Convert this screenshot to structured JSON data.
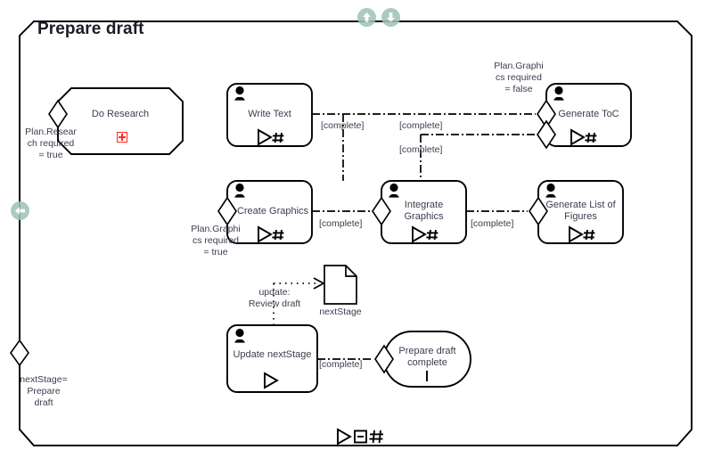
{
  "frame": {
    "title": "Prepare draft",
    "shape": "rounded-corner-activity-frame"
  },
  "scroll_controls": [
    {
      "name": "scroll-up-icon",
      "glyph": "arrow-up-circle"
    },
    {
      "name": "scroll-down-icon",
      "glyph": "arrow-down-circle"
    },
    {
      "name": "scroll-left-icon",
      "glyph": "arrow-left-circle"
    }
  ],
  "toolbar": {
    "glyphs": [
      "play-triangle",
      "collapse-box",
      "hash"
    ]
  },
  "colors": {
    "stroke": "#000000",
    "text": "#3c3c50",
    "title": "#1b1b24",
    "expand_marker": "#ff2a1f",
    "scroll_icon": "#9fc4b4"
  },
  "nodes": [
    {
      "id": "do-research",
      "label": "Do Research",
      "shape": "octagon",
      "has_actor_icon": false,
      "markers": [],
      "expand_marker": true,
      "pins": [
        "left-diamond"
      ]
    },
    {
      "id": "write-text",
      "label": "Write Text",
      "shape": "rounded-rect",
      "has_actor_icon": true,
      "markers": [
        "play-triangle",
        "hash"
      ],
      "expand_marker": false,
      "pins": []
    },
    {
      "id": "generate-toc",
      "label": "Generate ToC",
      "shape": "rounded-rect",
      "has_actor_icon": true,
      "markers": [
        "play-triangle",
        "hash"
      ],
      "expand_marker": false,
      "pins": [
        "left-diamond",
        "left-diamond"
      ]
    },
    {
      "id": "create-graphics",
      "label": "Create Graphics",
      "shape": "rounded-rect",
      "has_actor_icon": true,
      "markers": [
        "play-triangle",
        "hash"
      ],
      "expand_marker": false,
      "pins": [
        "left-diamond"
      ]
    },
    {
      "id": "integrate-graphics",
      "label": "Integrate\nGraphics",
      "shape": "rounded-rect",
      "has_actor_icon": true,
      "markers": [
        "play-triangle",
        "hash"
      ],
      "expand_marker": false,
      "pins": [
        "left-diamond"
      ]
    },
    {
      "id": "generate-list-of-figures",
      "label": "Generate List of\nFigures",
      "shape": "rounded-rect",
      "has_actor_icon": true,
      "markers": [
        "play-triangle",
        "hash"
      ],
      "expand_marker": false,
      "pins": [
        "left-diamond"
      ]
    },
    {
      "id": "update-nextstage",
      "label": "Update nextStage",
      "shape": "rounded-rect",
      "has_actor_icon": true,
      "markers": [
        "play-triangle"
      ],
      "expand_marker": false,
      "pins": []
    },
    {
      "id": "prepare-draft-complete",
      "label": "Prepare draft\ncomplete",
      "shape": "stadium",
      "has_actor_icon": false,
      "markers": [],
      "expand_marker": false,
      "pins": [
        "left-diamond"
      ]
    }
  ],
  "artifacts": [
    {
      "id": "nextstage-document",
      "label": "nextStage",
      "shape": "document"
    }
  ],
  "guards": [
    {
      "id": "guard-do-research",
      "text": "Plan.Resear\nch required\n= true"
    },
    {
      "id": "guard-create-graphics",
      "text": "Plan.Graphi\ncs required\n= true"
    },
    {
      "id": "guard-generate-toc",
      "text": "Plan.Graphi\ncs required\n= false"
    },
    {
      "id": "guard-frame-entry",
      "text": "nextStage=\nPrepare\ndraft"
    }
  ],
  "edge_labels": [
    {
      "id": "edge-write-text-out",
      "text": "[complete]"
    },
    {
      "id": "edge-to-generate-toc",
      "text": "[complete]"
    },
    {
      "id": "edge-integrate-to-toc",
      "text": "[complete]"
    },
    {
      "id": "edge-create-graphics-out",
      "text": "[complete]"
    },
    {
      "id": "edge-integrate-to-figures",
      "text": "[complete]"
    },
    {
      "id": "edge-update-to-complete",
      "text": "[complete]"
    },
    {
      "id": "edge-update-nextstage-artifact",
      "text": "update:\nReview draft"
    }
  ]
}
